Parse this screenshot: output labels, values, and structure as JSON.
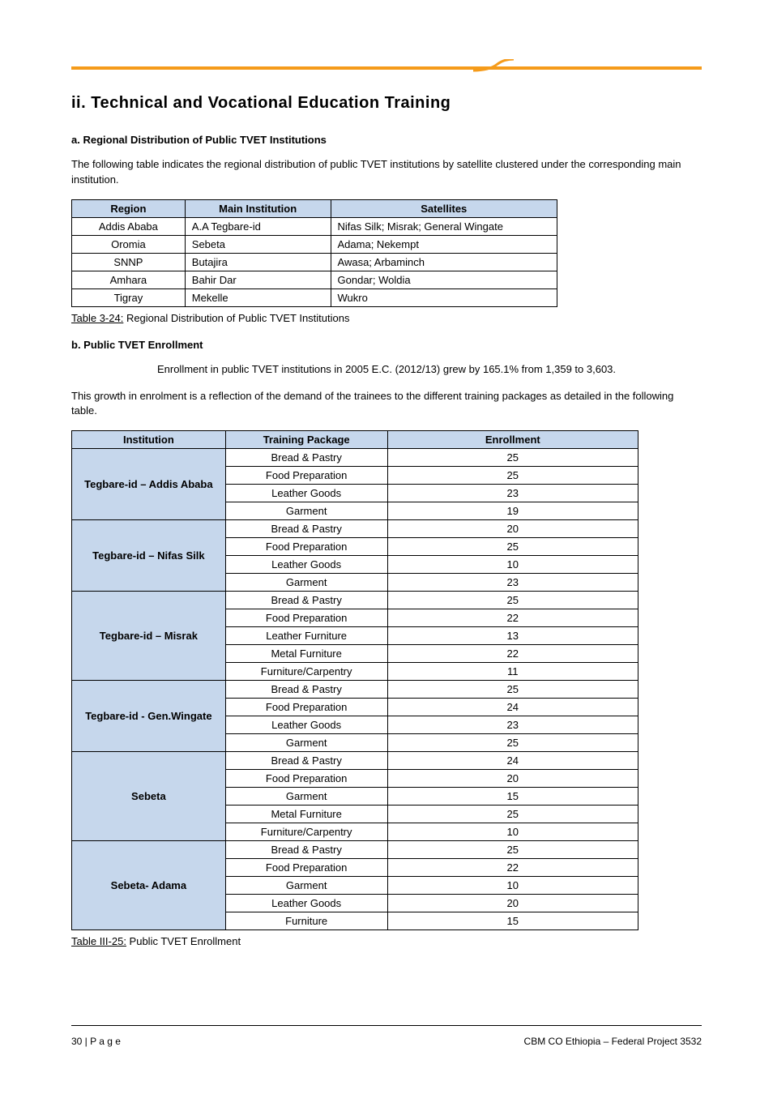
{
  "page_title_text": "ii. Technical and Vocational Education Training",
  "section_heading": "a. Regional Distribution of Public TVET Institutions",
  "intro_para": "The following table indicates the regional distribution of public TVET institutions by satellite clustered under the corresponding main institution.",
  "table1": {
    "headers": [
      "Region",
      "Main Institution",
      "Satellites"
    ],
    "rows": [
      [
        "Addis Ababa",
        "A.A Tegbare-id",
        "Nifas Silk; Misrak; General Wingate"
      ],
      [
        "Oromia",
        "Sebeta",
        "Adama; Nekempt"
      ],
      [
        "SNNP",
        "Butajira",
        "Awasa; Arbaminch"
      ],
      [
        "Amhara",
        "Bahir Dar",
        "Gondar; Woldia"
      ],
      [
        "Tigray",
        "Mekelle",
        "Wukro"
      ]
    ],
    "caption_num": "Table 3-24:",
    "caption_text": " Regional Distribution of Public TVET Institutions"
  },
  "mid_heading": "b. Public TVET Enrollment",
  "mid_para_1": "Enrollment in public TVET institutions in 2005 E.C. (2012/13) grew by 165.1% from 1,359 to 3,603.",
  "mid_para_2": "This growth in enrolment is a reflection of the demand of the trainees to the different training packages as detailed in the following table.",
  "table2": {
    "headers": [
      "Institution",
      "Training Package",
      "Enrollment"
    ],
    "groups": [
      {
        "institution": "Tegbare-id – Addis Ababa",
        "rows": [
          [
            "Bread & Pastry",
            "25"
          ],
          [
            "Food Preparation",
            "25"
          ],
          [
            "Leather Goods",
            "23"
          ],
          [
            "Garment",
            "19"
          ]
        ]
      },
      {
        "institution": "Tegbare-id – Nifas Silk",
        "rows": [
          [
            "Bread & Pastry",
            "20"
          ],
          [
            "Food Preparation",
            "25"
          ],
          [
            "Leather Goods",
            "10"
          ],
          [
            "Garment",
            "23"
          ]
        ]
      },
      {
        "institution": "Tegbare-id – Misrak",
        "rows": [
          [
            "Bread & Pastry",
            "25"
          ],
          [
            "Food Preparation",
            "22"
          ],
          [
            "Leather Furniture",
            "13"
          ],
          [
            "Metal Furniture",
            "22"
          ],
          [
            "Furniture/Carpentry",
            "11"
          ]
        ]
      },
      {
        "institution": "Tegbare-id - Gen.Wingate",
        "rows": [
          [
            "Bread & Pastry",
            "25"
          ],
          [
            "Food Preparation",
            "24"
          ],
          [
            "Leather Goods",
            "23"
          ],
          [
            "Garment",
            "25"
          ]
        ]
      },
      {
        "institution": "Sebeta",
        "rows": [
          [
            "Bread & Pastry",
            "24"
          ],
          [
            "Food Preparation",
            "20"
          ],
          [
            "Garment",
            "15"
          ],
          [
            "Metal Furniture",
            "25"
          ],
          [
            "Furniture/Carpentry",
            "10"
          ]
        ]
      },
      {
        "institution": "Sebeta- Adama",
        "rows": [
          [
            "Bread & Pastry",
            "25"
          ],
          [
            "Food Preparation",
            "22"
          ],
          [
            "Garment",
            "10"
          ],
          [
            "Leather Goods",
            "20"
          ],
          [
            "Furniture",
            "15"
          ]
        ]
      }
    ],
    "caption_num": "Table III-25:",
    "caption_text": " Public TVET Enrollment"
  },
  "footer_left": "30 | P a g e",
  "footer_right": "CBM CO Ethiopia – Federal Project 3532"
}
